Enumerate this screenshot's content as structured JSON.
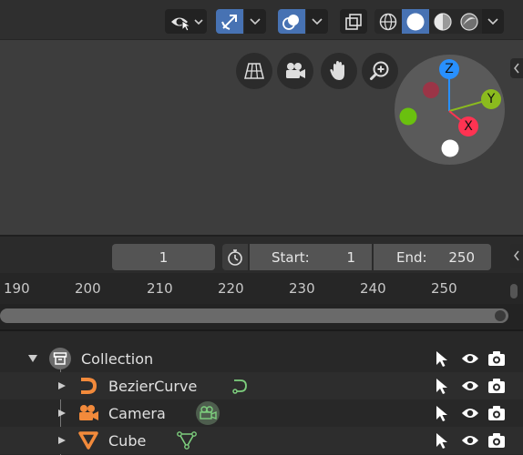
{
  "viewport": {
    "gizmo_axes": {
      "z": "Z",
      "y": "Y",
      "x": "X"
    }
  },
  "timeline": {
    "current_frame": "1",
    "start_label": "Start:",
    "start_value": "1",
    "end_label": "End:",
    "end_value": "250",
    "ruler_ticks": [
      "190",
      "200",
      "210",
      "220",
      "230",
      "240",
      "250"
    ]
  },
  "outliner": {
    "rows": [
      {
        "label": "Collection",
        "icon": "collection-icon"
      },
      {
        "label": "BezierCurve",
        "icon": "curve-icon"
      },
      {
        "label": "Camera",
        "icon": "camera-icon"
      },
      {
        "label": "Cube",
        "icon": "mesh-icon"
      }
    ]
  },
  "colors": {
    "accent": "#4772b3",
    "axis_x": "#ff3352",
    "axis_y": "#8bbb1e",
    "axis_z": "#2890ff",
    "object_orange": "#f28a3b",
    "data_green": "#7ecf7e"
  }
}
